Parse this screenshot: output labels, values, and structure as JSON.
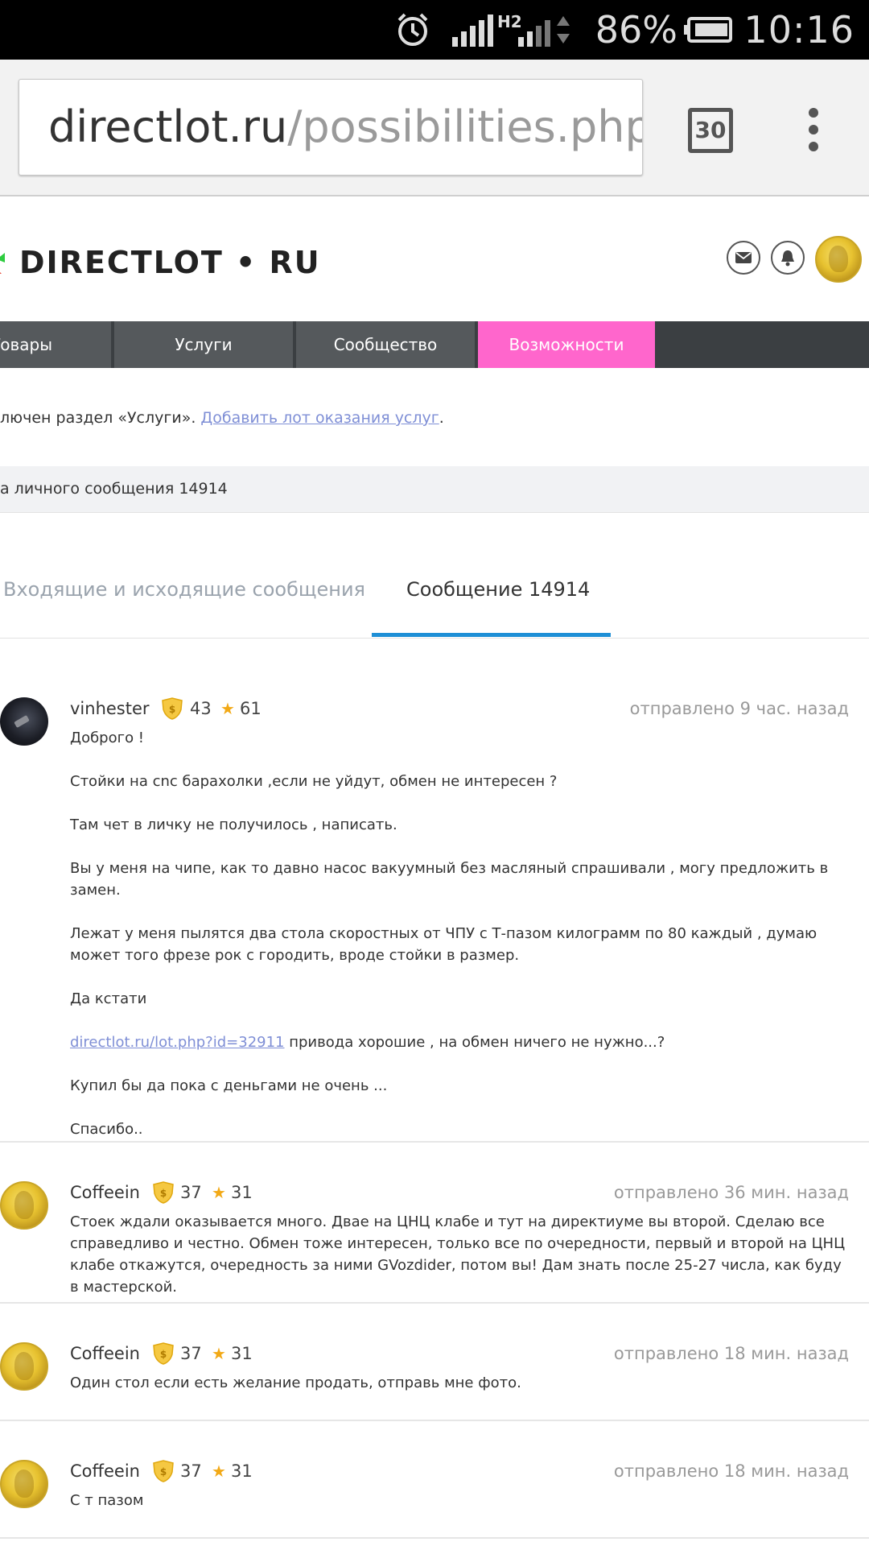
{
  "status_bar": {
    "network": "H2",
    "battery_pct": "86%",
    "time": "10:16"
  },
  "browser": {
    "url_host": "directlot.ru",
    "url_path": "/possibilities.php?",
    "tab_count": "30"
  },
  "site": {
    "logo_text": "DIRECTLOT • RU",
    "nav": [
      {
        "label": "Товары"
      },
      {
        "label": "Услуги"
      },
      {
        "label": "Сообщество"
      },
      {
        "label": "Возможности"
      }
    ],
    "notice_text": "лючен раздел «Услуги». ",
    "notice_link": "Добавить лот оказания услуг",
    "notice_end": ".",
    "crumb": "а личного сообщения 14914",
    "tabs": [
      {
        "label": "Входящие и исходящие сообщения"
      },
      {
        "label": "Сообщение 14914"
      }
    ]
  },
  "messages": [
    {
      "author": "vinhester",
      "badge_count": "43",
      "stars": "61",
      "time": "отправлено 9 час. назад",
      "paragraphs": [
        "Доброго !",
        "Стойки на cnc барахолки ,если не уйдут, обмен не интересен ?",
        "Там чет в личку не получилось , написать.",
        "Вы у меня на чипе, как то давно насос вакуумный без масляный спрашивали , могу предложить в замен.",
        "Лежат у меня пылятся два стола скоростных от ЧПУ с Т-пазом килограмм по 80 каждый , думаю может того фрезе рок с городить, вроде стойки в размер.",
        "Да кстати"
      ],
      "link": "directlot.ru/lot.php?id=32911",
      "link_after": " привода хорошие , на обмен ничего не нужно...?",
      "paragraphs_end": [
        "Купил бы да пока с деньгами не очень ...",
        "Спасибо.."
      ]
    },
    {
      "author": "Coffeein",
      "badge_count": "37",
      "stars": "31",
      "time": "отправлено 36 мин. назад",
      "text": "Стоек ждали оказывается много. Двае на ЦНЦ клабе и тут на директиуме вы второй. Сделаю все справедливо и честно. Обмен тоже интересен, только все по очередности, первый и второй на ЦНЦ клабе откажутся, очередность за ними GVozdider, потом вы! Дам знать после 25-27 числа, как буду в мастерской."
    },
    {
      "author": "Coffeein",
      "badge_count": "37",
      "stars": "31",
      "time": "отправлено 18 мин. назад",
      "text": "Один стол если есть желание продать, отправь мне фото."
    },
    {
      "author": "Coffeein",
      "badge_count": "37",
      "stars": "31",
      "time": "отправлено 18 мин. назад",
      "text": "С т пазом"
    }
  ],
  "icons": {
    "alarm": "alarm-clock-icon",
    "signal": "signal-icon",
    "battery": "battery-icon",
    "tabs": "tab-switcher-icon",
    "menu": "overflow-menu-icon",
    "mail": "mail-icon",
    "bell": "bell-icon",
    "badge": "shield-badge-icon",
    "star": "star-icon"
  },
  "colors": {
    "nav_active": "#ff66cc",
    "tab_underline": "#1e8fd6",
    "link": "#7f8fd6",
    "star": "#f2a916"
  }
}
